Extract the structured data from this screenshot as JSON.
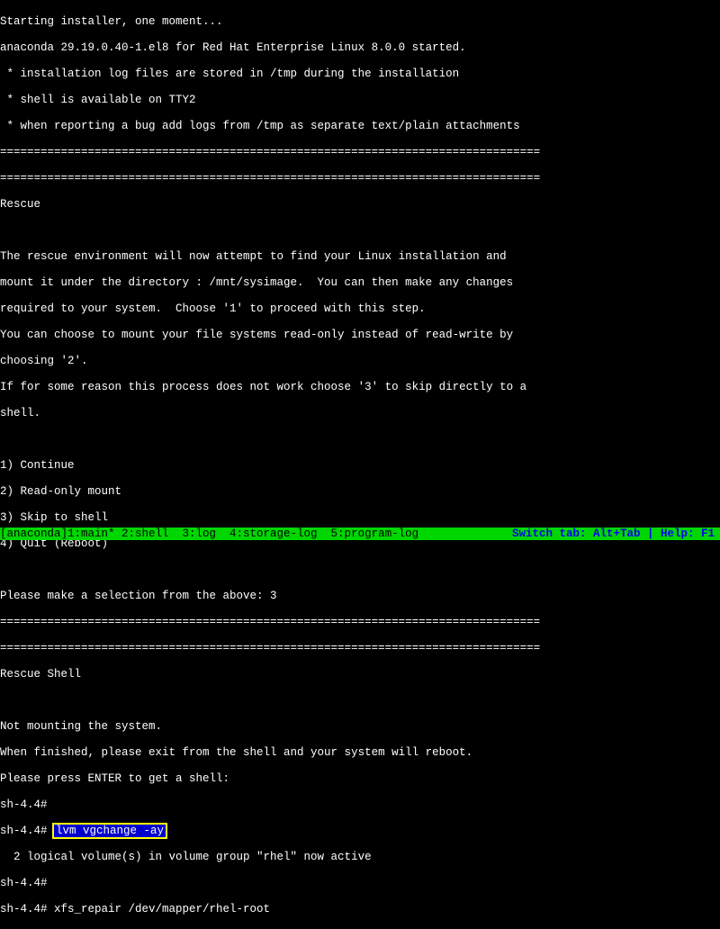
{
  "lines": {
    "l0": "Starting installer, one moment...",
    "l1": "anaconda 29.19.0.40-1.el8 for Red Hat Enterprise Linux 8.0.0 started.",
    "l2": " * installation log files are stored in /tmp during the installation",
    "l3": " * shell is available on TTY2",
    "l4": " * when reporting a bug add logs from /tmp as separate text/plain attachments",
    "divider": "================================================================================",
    "l5": "Rescue",
    "blank": " ",
    "l6": "The rescue environment will now attempt to find your Linux installation and",
    "l7": "mount it under the directory : /mnt/sysimage.  You can then make any changes",
    "l8": "required to your system.  Choose '1' to proceed with this step.",
    "l9": "You can choose to mount your file systems read-only instead of read-write by",
    "l10": "choosing '2'.",
    "l11": "If for some reason this process does not work choose '3' to skip directly to a",
    "l12": "shell.",
    "m1": "1) Continue",
    "m2": "2) Read-only mount",
    "m3": "3) Skip to shell",
    "m4": "4) Quit (Reboot)",
    "p1": "Please make a selection from the above: 3",
    "rs": "Rescue Shell",
    "n1": "Not mounting the system.",
    "n2": "When finished, please exit from the shell and your system will reboot.",
    "n3": "Please press ENTER to get a shell:",
    "s1": "sh-4.4#",
    "s2a": "sh-4.4# ",
    "s2b": "lvm vgchange -ay",
    "s3": "  2 logical volume(s) in volume group \"rhel\" now active",
    "s4": "sh-4.4#",
    "s5": "sh-4.4# xfs_repair /dev/mapper/rhel-root"
  },
  "status": {
    "left": "[anaconda]1:main* 2:shell  3:log  4:storage-log  5:program-log",
    "right": "Switch tab: Alt+Tab | Help: F1"
  }
}
